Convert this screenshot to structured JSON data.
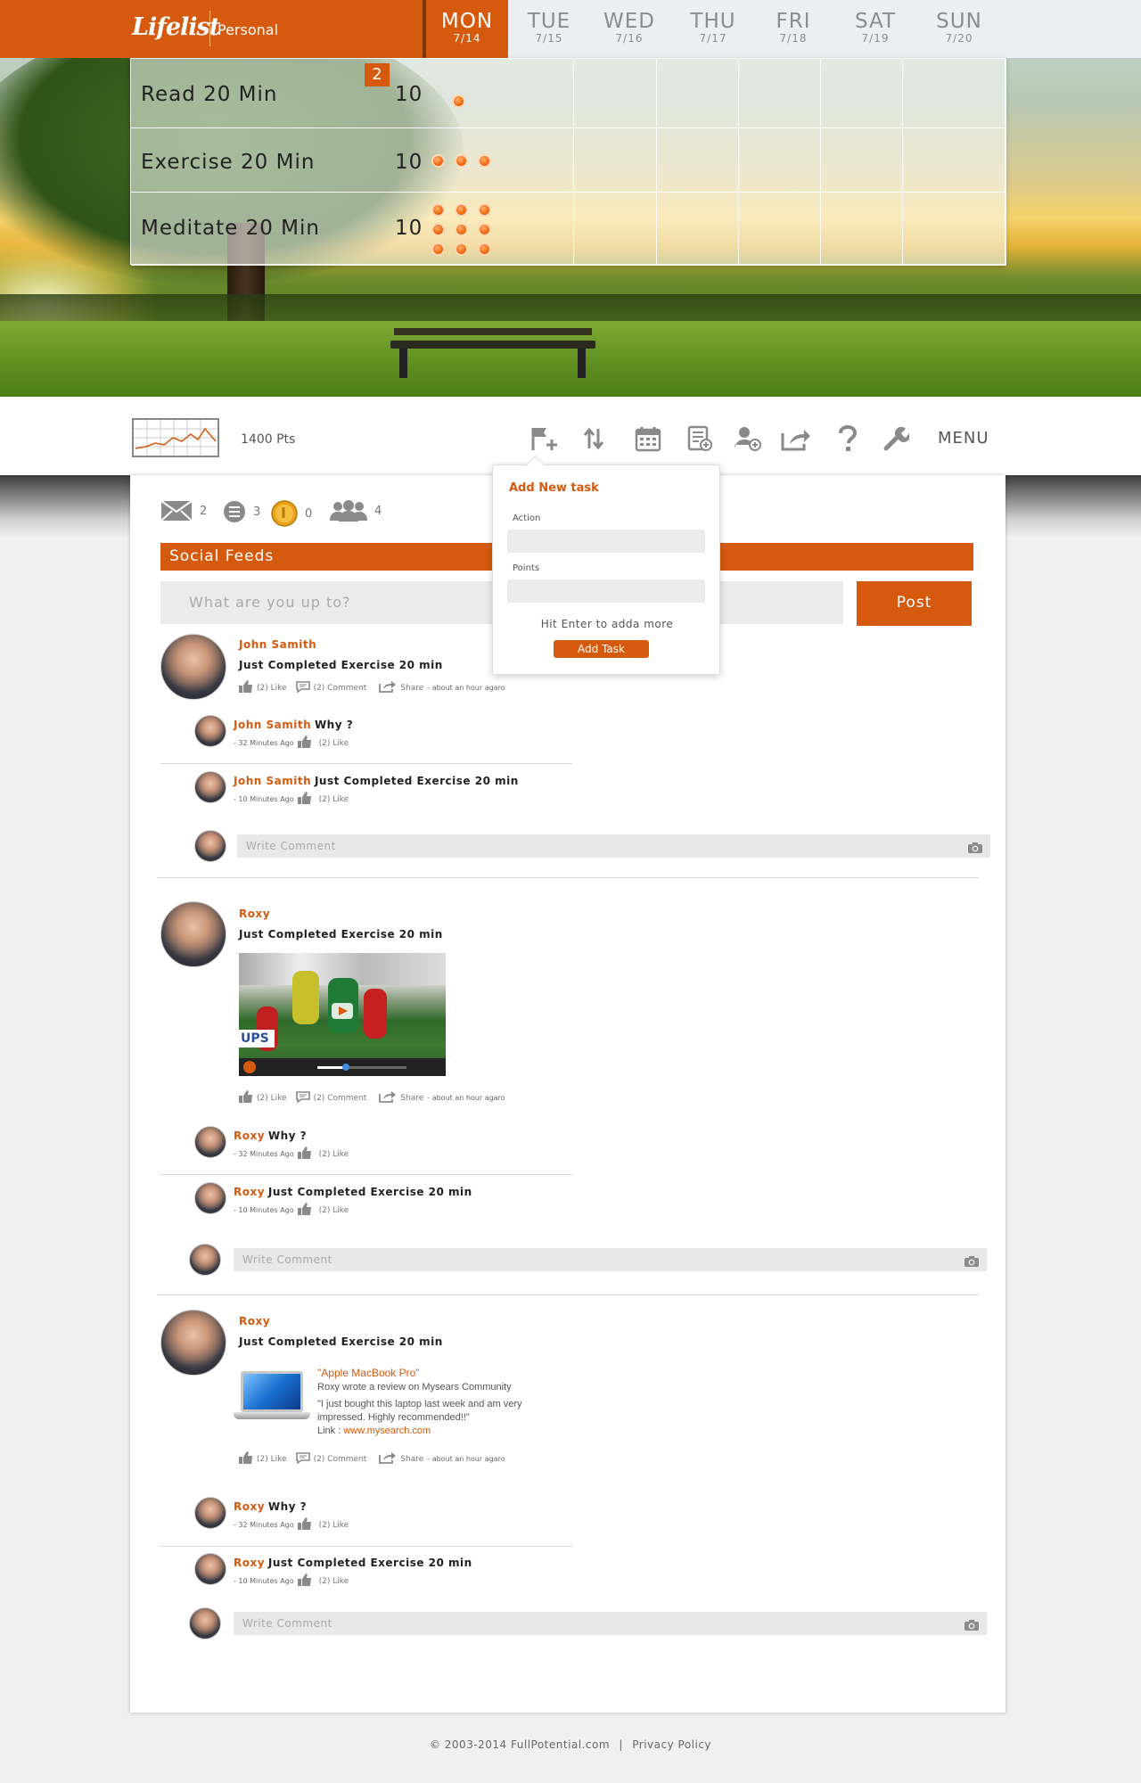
{
  "brand": {
    "logo": "Lifelist",
    "section": "Personal",
    "accent": "#d65a0e"
  },
  "days": [
    {
      "name": "MON",
      "date": "7/14",
      "active": true
    },
    {
      "name": "TUE",
      "date": "7/15"
    },
    {
      "name": "WED",
      "date": "7/16"
    },
    {
      "name": "THU",
      "date": "7/17"
    },
    {
      "name": "FRI",
      "date": "7/18"
    },
    {
      "name": "SAT",
      "date": "7/19"
    },
    {
      "name": "SUN",
      "date": "7/20"
    }
  ],
  "tasks": [
    {
      "name": "Read 20 Min",
      "points": "10",
      "badge": "2",
      "completed": 1
    },
    {
      "name": "Exercise 20 Min",
      "points": "10",
      "completed": 3
    },
    {
      "name": "Meditate 20 Min",
      "points": "10",
      "completed": 9
    }
  ],
  "toolbar": {
    "points": "1400 Pts",
    "menu": "MENU",
    "icons": [
      "add-task-icon",
      "sync-icon",
      "calendar-icon",
      "add-list-icon",
      "add-user-icon",
      "share-icon",
      "help-icon",
      "settings-icon"
    ]
  },
  "popup": {
    "title": "Add New task",
    "action_label": "Action",
    "points_label": "Points",
    "hint": "Hit Enter to adda more",
    "button": "Add Task"
  },
  "stats": {
    "messages": "2",
    "lists": "3",
    "coins": "0",
    "friends": "4"
  },
  "feed": {
    "title": "Social Feeds",
    "placeholder": "What are you up to?",
    "post_button": "Post"
  },
  "actions": {
    "like": "(2) Like",
    "comment": "(2) Comment",
    "share": "Share",
    "time": "- about an hour agaro"
  },
  "posts": [
    {
      "name": "John Samith",
      "text": "Just Completed Exercise 20 min",
      "comments": [
        {
          "name": "John Samith",
          "text": "Why ?",
          "ago": "- 32 Minutes Ago",
          "like": "(2) Like"
        },
        {
          "name": "John Samith",
          "text": "Just Completed Exercise 20 min",
          "ago": "- 10 Minutes Ago",
          "like": "(2) Like"
        }
      ],
      "write": "Write Comment"
    },
    {
      "name": "Roxy",
      "text": "Just Completed Exercise 20 min",
      "comments": [
        {
          "name": "Roxy",
          "text": "Why ?",
          "ago": "- 32 Minutes Ago",
          "like": "(2) Like"
        },
        {
          "name": "Roxy",
          "text": "Just Completed Exercise 20 min",
          "ago": "- 10 Minutes Ago",
          "like": "(2) Like"
        }
      ],
      "write": "Write Comment"
    },
    {
      "name": "Roxy",
      "text": "Just Completed Exercise 20 min",
      "review": {
        "title": "\"Apple MacBook Pro\"",
        "line1": "Roxy wrote a review on Mysears Community",
        "quote": "\"I just bought this laptop last week and am very impressed. Highly recommended!!\"",
        "link_label": "Link : ",
        "link": "www.mysearch.com"
      },
      "comments": [
        {
          "name": "Roxy",
          "text": "Why ?",
          "ago": "- 32 Minutes Ago",
          "like": "(2) Like"
        },
        {
          "name": "Roxy",
          "text": "Just Completed Exercise 20 min",
          "ago": "- 10 Minutes Ago",
          "like": "(2) Like"
        }
      ],
      "write": "Write Comment"
    }
  ],
  "footer": {
    "copyright": "© 2003-2014 FullPotential.com",
    "sep": "|",
    "privacy": "Privacy Policy"
  }
}
